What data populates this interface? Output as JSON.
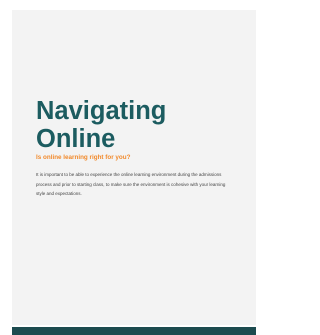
{
  "cover": {
    "title_line1": "Navigating",
    "title_line2": "Online",
    "subtitle": "Is online learning right for you?",
    "body": "It is important to be able to experience the online learning environment during the admissions process and prior to starting class, to make sure the environment is cohesive with your learning style and expectations."
  },
  "colors": {
    "title": "#1c5c60",
    "subtitle": "#f28a2c",
    "background": "#f3f3f3",
    "footer_band": "#1c4b4f"
  }
}
